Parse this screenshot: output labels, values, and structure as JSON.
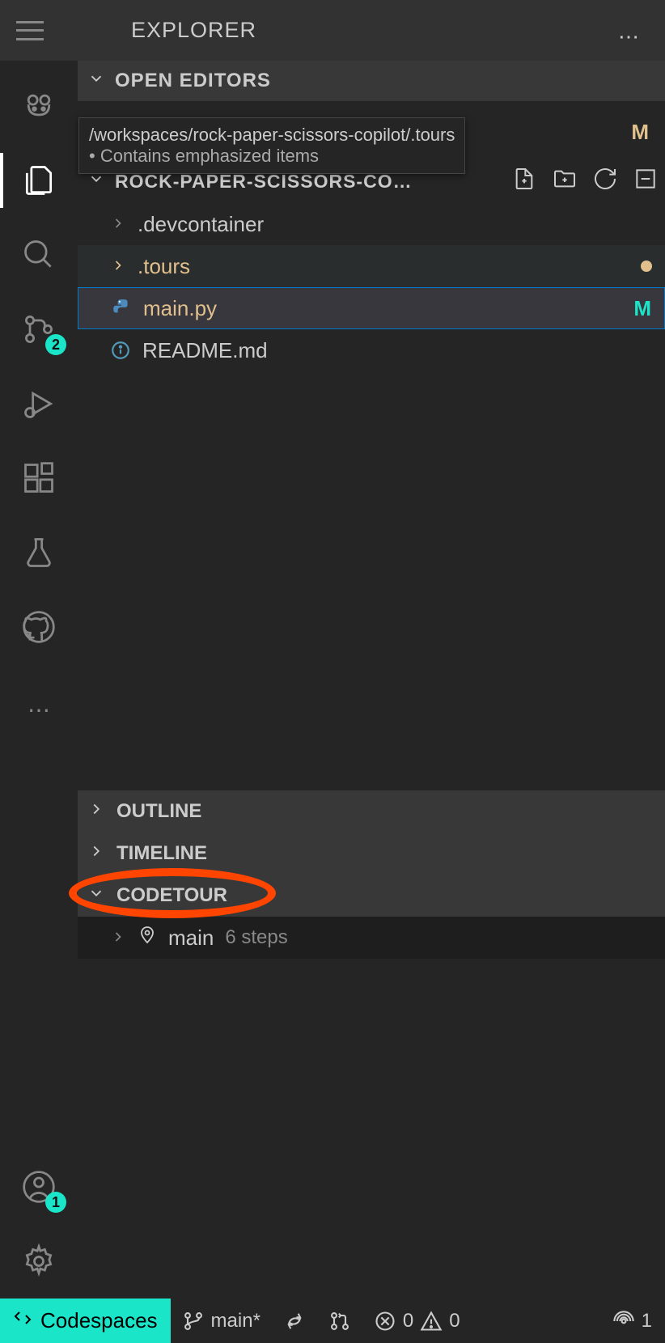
{
  "titlebar": {
    "title": "EXPLORER"
  },
  "activityBadges": {
    "sourceControl": "2",
    "account": "1"
  },
  "sections": {
    "openEditors": "OPEN EDITORS",
    "projectName": "ROCK-PAPER-SCISSORS-COPI…",
    "outline": "OUTLINE",
    "timeline": "TIMELINE",
    "codetour": "CODETOUR"
  },
  "tooltip": {
    "path": "/workspaces/rock-paper-scissors-copilot/.tours",
    "note": "• Contains emphasized items"
  },
  "tree": {
    "devcontainer": ".devcontainer",
    "tours": ".tours",
    "mainpy": "main.py",
    "mainpyBadge": "M",
    "readme": "README.md",
    "mBadgeTop": "M"
  },
  "codetour": {
    "name": "main",
    "steps": "6 steps"
  },
  "statusbar": {
    "codespaces": "Codespaces",
    "branch": "main*",
    "errors": "0",
    "warnings": "0",
    "ports": "1"
  }
}
